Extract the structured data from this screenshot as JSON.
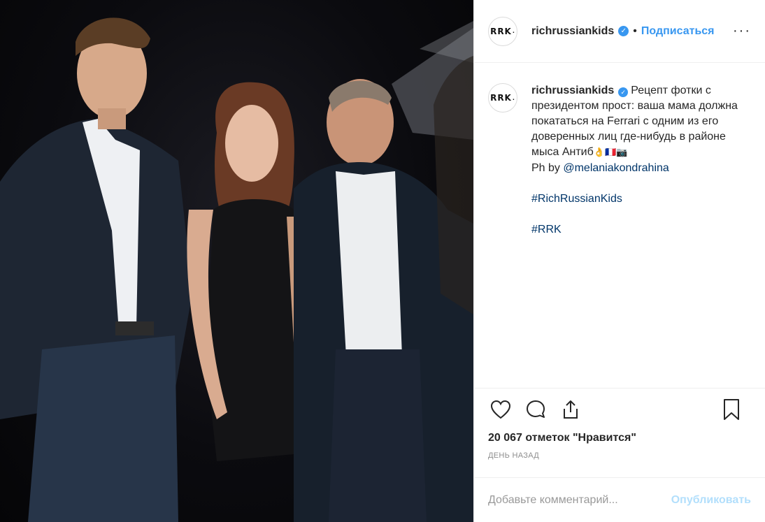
{
  "post": {
    "photo_alt": "",
    "author": {
      "avatar_text": "RRK",
      "avatar_dot": ".",
      "username": "richrussiankids",
      "verified_icon": "verified-badge-icon",
      "separator": "•",
      "follow_label": "Подписаться",
      "more_icon": "more-options-icon",
      "more_label": "···"
    },
    "caption": {
      "avatar_text": "RRK",
      "avatar_dot": ".",
      "username": "richrussiankids",
      "text": "Рецепт фотки с президентом прост: ваша мама должна покататься на Ferrari с одним из его доверенных лиц где-нибудь в районе мыса Антиб",
      "emojis": "👌🇫🇷📷",
      "credit_prefix": "Ph by ",
      "credit_handle": "@melaniakondrahina",
      "hashtag_1": "#RichRussianKids",
      "hashtag_2": "#RRK"
    },
    "actions": {
      "like_icon": "heart-icon",
      "comment_icon": "comment-icon",
      "share_icon": "share-icon",
      "save_icon": "bookmark-icon"
    },
    "likes_text": "20 067 отметок \"Нравится\"",
    "timestamp": "ДЕНЬ НАЗАД",
    "comment": {
      "placeholder": "Добавьте комментарий...",
      "publish_label": "Опубликовать"
    }
  },
  "colors": {
    "accent": "#3897f0",
    "link": "#003569",
    "publish_disabled": "#b2dffc",
    "muted": "#8e8e8e"
  }
}
